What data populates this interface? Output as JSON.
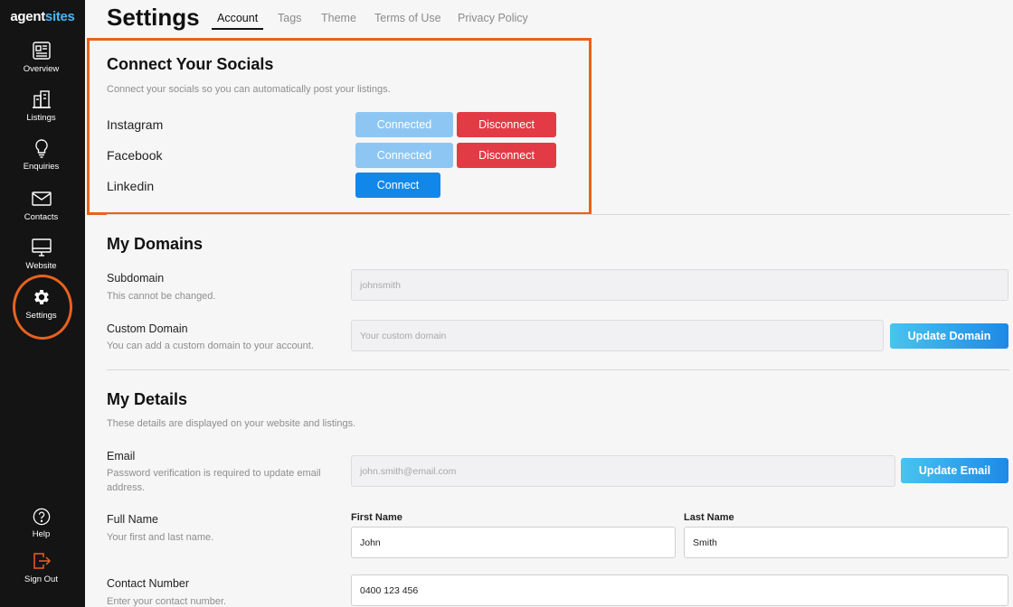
{
  "logo": {
    "part1": "agent",
    "part2": "sites"
  },
  "nav": {
    "overview": "Overview",
    "listings": "Listings",
    "enquiries": "Enquiries",
    "contacts": "Contacts",
    "website": "Website",
    "settings": "Settings",
    "help": "Help",
    "signout": "Sign Out"
  },
  "header": {
    "title": "Settings",
    "tabs": [
      "Account",
      "Tags",
      "Theme",
      "Terms of Use",
      "Privacy Policy"
    ]
  },
  "socials": {
    "title": "Connect Your Socials",
    "description": "Connect your socials so you can automatically post your listings.",
    "items": [
      {
        "name": "Instagram",
        "connected_label": "Connected",
        "disconnect_label": "Disconnect"
      },
      {
        "name": "Facebook",
        "connected_label": "Connected",
        "disconnect_label": "Disconnect"
      },
      {
        "name": "Linkedin",
        "connect_label": "Connect"
      }
    ]
  },
  "domains": {
    "title": "My Domains",
    "subdomain": {
      "label": "Subdomain",
      "description": "This cannot be changed.",
      "value": "johnsmith"
    },
    "custom": {
      "label": "Custom Domain",
      "description": "You can add a custom domain to your account.",
      "placeholder": "Your custom domain",
      "button": "Update Domain"
    }
  },
  "details": {
    "title": "My Details",
    "description": "These details are displayed on your website and listings.",
    "email": {
      "label": "Email",
      "description_line1": "Password verification is required to update email",
      "description_line2": "address.",
      "value": "john.smith@email.com",
      "button": "Update Email"
    },
    "full_name": {
      "label": "Full Name",
      "description": "Your first and last name.",
      "first_label": "First Name",
      "first_value": "John",
      "last_label": "Last Name",
      "last_value": "Smith"
    },
    "contact": {
      "label": "Contact Number",
      "description": "Enter your contact number.",
      "value": "0400 123 456"
    }
  },
  "colors": {
    "accent": "#1287ea",
    "danger": "#e33b46",
    "highlight": "#e8621e",
    "sidebar": "#141414"
  }
}
